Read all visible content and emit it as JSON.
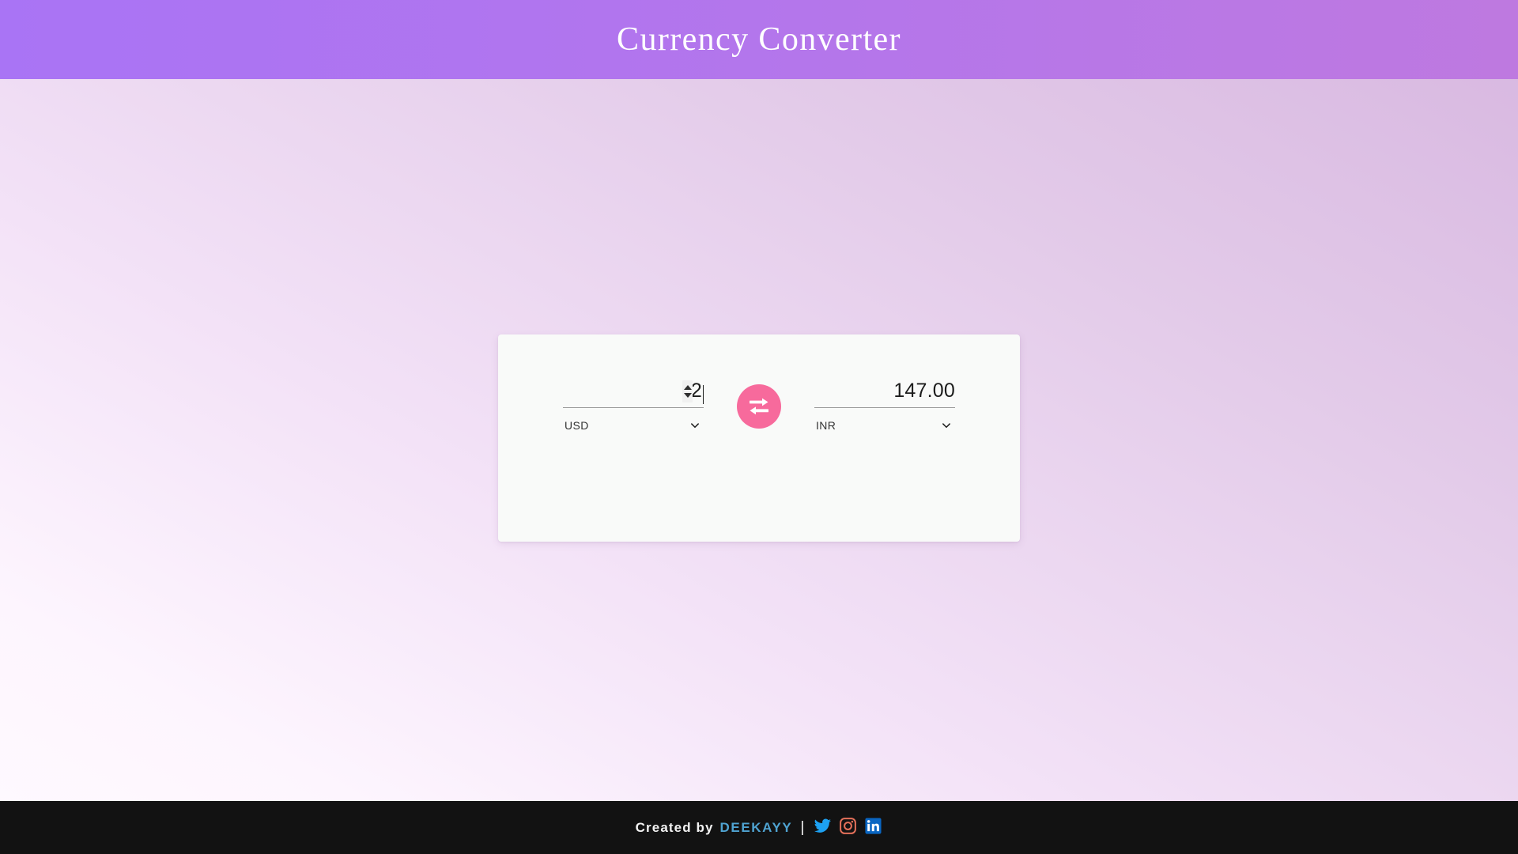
{
  "header": {
    "title": "Currency Converter",
    "gradient_from": "#A974F5",
    "gradient_to": "#BE79E0"
  },
  "page": {
    "background_from": "#D7B6E0",
    "background_to": "#FDF5FE"
  },
  "converter": {
    "card_background": "#F9FAF9",
    "from": {
      "amount": "2",
      "currency": "USD",
      "spinner_up_icon": "triangle-up-icon",
      "spinner_down_icon": "triangle-down-icon",
      "chevron_icon": "chevron-down-icon"
    },
    "to": {
      "amount": "147.00",
      "currency": "INR",
      "chevron_icon": "chevron-down-icon"
    },
    "swap": {
      "icon": "swap-horizontal-arrows-icon",
      "color": "#F76A9C",
      "label": "Swap currencies"
    }
  },
  "footer": {
    "created_label": "Created by",
    "author": "DEEKAYY",
    "separator": "|",
    "background": "#121212",
    "author_color": "#4FA3D1",
    "socials": [
      {
        "name": "twitter-icon",
        "color": "#1DA1F2"
      },
      {
        "name": "instagram-icon",
        "color": "#E4705A"
      },
      {
        "name": "linkedin-icon",
        "color": "#0A66C2"
      }
    ]
  }
}
